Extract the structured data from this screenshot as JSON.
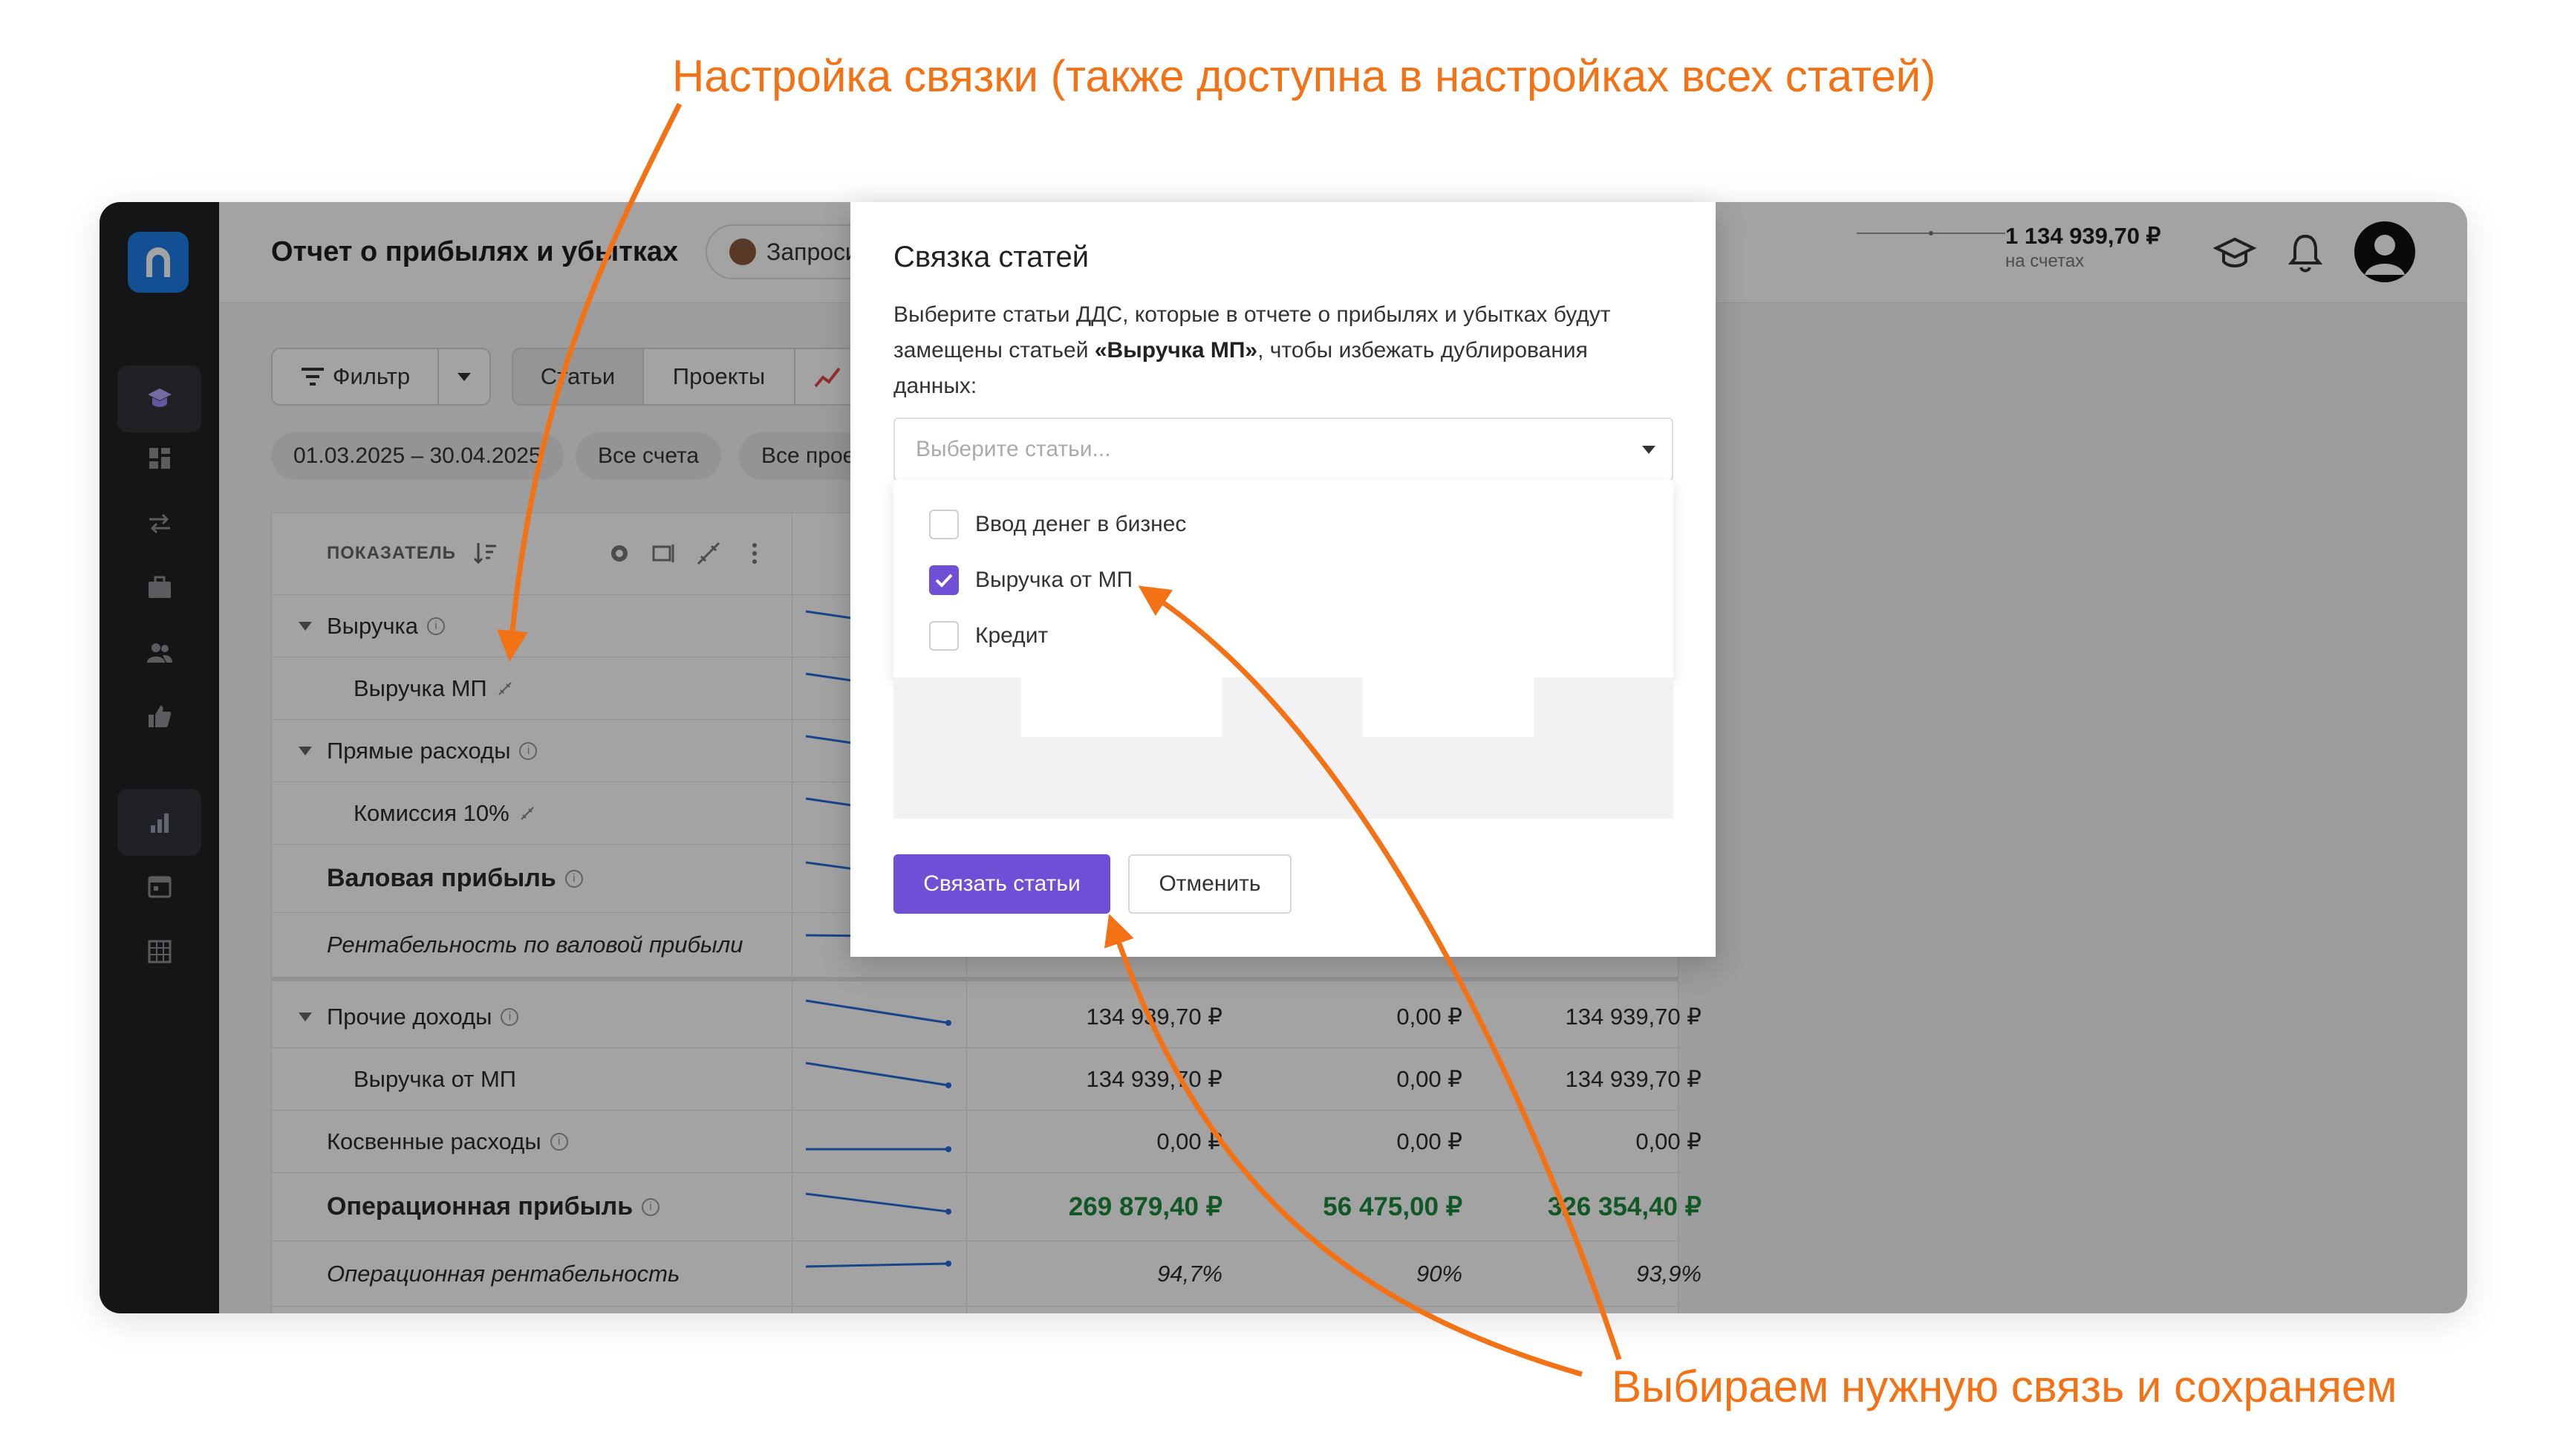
{
  "annotations": {
    "top": "Настройка связки (также доступна в настройках всех статей)",
    "bottom": "Выбираем нужную связь и сохраняем"
  },
  "colors": {
    "accent": "#6e4fd6",
    "annotation": "#f47216",
    "positive": "#1b8a3c",
    "logo": "#1f7de6"
  },
  "sidebar": {
    "icons": [
      "logo-icon",
      "graduation-cap-icon",
      "dashboard-icon",
      "transfer-icon",
      "briefcase-icon",
      "users-icon",
      "thumb-up-icon",
      "bar-chart-icon",
      "calendar-icon",
      "table-icon"
    ]
  },
  "header": {
    "title": "Отчет о прибылях и убытках",
    "request_chip": "Запроси",
    "balance_amount": "1 134 939,70 ₽",
    "balance_sub": "на счетах"
  },
  "toolbar": {
    "filter": "Фильтр",
    "tab_articles": "Статьи",
    "tab_projects": "Проекты"
  },
  "chips": {
    "date": "01.03.2025 – 30.04.2025",
    "accounts": "Все счета",
    "projects": "Все прое"
  },
  "table": {
    "column_header": "ПОКАЗАТЕЛЬ",
    "rows": [
      {
        "label": "Выручка",
        "v1": "",
        "v2": "",
        "v3": ""
      },
      {
        "label": "Выручка МП",
        "v1": "",
        "v2": "",
        "v3": ""
      },
      {
        "label": "Прямые расходы",
        "v1": "",
        "v2": "",
        "v3": ""
      },
      {
        "label": "Комиссия 10%",
        "v1": "",
        "v2": "",
        "v3": ""
      },
      {
        "label": "Валовая прибыль",
        "v1": "",
        "v2": "",
        "v3": ""
      },
      {
        "label": "Рентабельность по валовой прибыли",
        "v1": "",
        "v2": "",
        "v3": ""
      },
      {
        "label": "Прочие доходы",
        "v1": "134 939,70 ₽",
        "v2": "0,00 ₽",
        "v3": "134 939,70 ₽"
      },
      {
        "label": "Выручка от МП",
        "v1": "134 939,70 ₽",
        "v2": "0,00 ₽",
        "v3": "134 939,70 ₽"
      },
      {
        "label": "Косвенные расходы",
        "v1": "0,00 ₽",
        "v2": "0,00 ₽",
        "v3": "0,00 ₽"
      },
      {
        "label": "Операционная прибыль",
        "v1": "269 879,40 ₽",
        "v2": "56 475,00 ₽",
        "v3": "326 354,40 ₽"
      },
      {
        "label": "Операционная рентабельность",
        "v1": "94,7%",
        "v2": "90%",
        "v3": "93,9%"
      }
    ]
  },
  "modal": {
    "title": "Связка статей",
    "desc_1": "Выберите статьи ДДС, которые в отчете о прибылях и убытках будут замещены статьей ",
    "desc_bold": "«Выручка МП»",
    "desc_2": ", чтобы избежать дублирования данных:",
    "placeholder": "Выберите статьи...",
    "options": [
      {
        "label": "Ввод денег в бизнес",
        "checked": false
      },
      {
        "label": "Выручка от МП",
        "checked": true
      },
      {
        "label": "Кредит",
        "checked": false
      }
    ],
    "submit": "Связать статьи",
    "cancel": "Отменить"
  }
}
